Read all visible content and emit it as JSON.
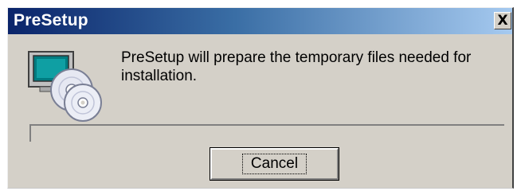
{
  "window": {
    "title": "PreSetup",
    "close_glyph": "X"
  },
  "message": "PreSetup will prepare the temporary files needed for installation.",
  "progress": {
    "fraction": 0
  },
  "buttons": {
    "cancel_label": "Cancel"
  },
  "icons": {
    "main": "computer-with-discs-icon",
    "close": "close-icon"
  },
  "colors": {
    "titlebar_start": "#0a246a",
    "titlebar_end": "#a6caf0",
    "dialog_face": "#d4d0c8",
    "title_text": "#ffffff"
  }
}
